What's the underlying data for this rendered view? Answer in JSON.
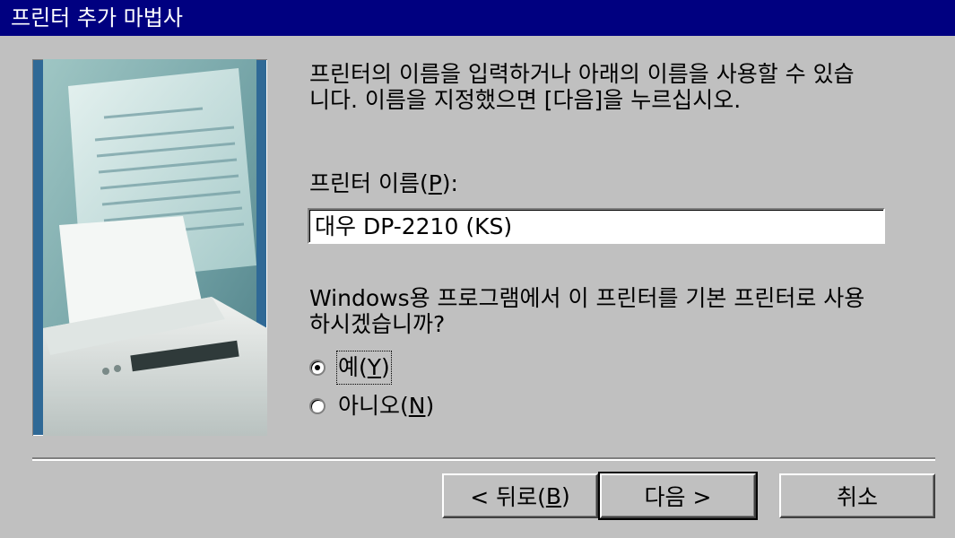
{
  "window": {
    "title": "프린터 추가 마법사"
  },
  "instructions": {
    "line1": "프린터의 이름을 입력하거나 아래의 이름을 사용할 수 있습",
    "line2": "니다. 이름을 지정했으면 [다음]을 누르십시오."
  },
  "printer_name": {
    "label_prefix": "프린터 이름(",
    "label_accel": "P",
    "label_suffix": "):",
    "value": "대우 DP-2210 (KS)"
  },
  "default_question": {
    "line1": "Windows용 프로그램에서 이 프린터를 기본 프린터로 사용",
    "line2": "하시겠습니까?"
  },
  "radios": {
    "yes": {
      "prefix": "예(",
      "accel": "Y",
      "suffix": ")",
      "selected": true
    },
    "no": {
      "prefix": "아니오(",
      "accel": "N",
      "suffix": ")",
      "selected": false
    }
  },
  "buttons": {
    "back": {
      "prefix": "< 뒤로(",
      "accel": "B",
      "suffix": ")"
    },
    "next": "다음 >",
    "cancel": "취소"
  },
  "colors": {
    "titlebar": "#000080",
    "face": "#c0c0c0",
    "hero_frame": "#2f6996"
  },
  "icons": {
    "wizard_image": "printer-with-paper-illustration"
  }
}
